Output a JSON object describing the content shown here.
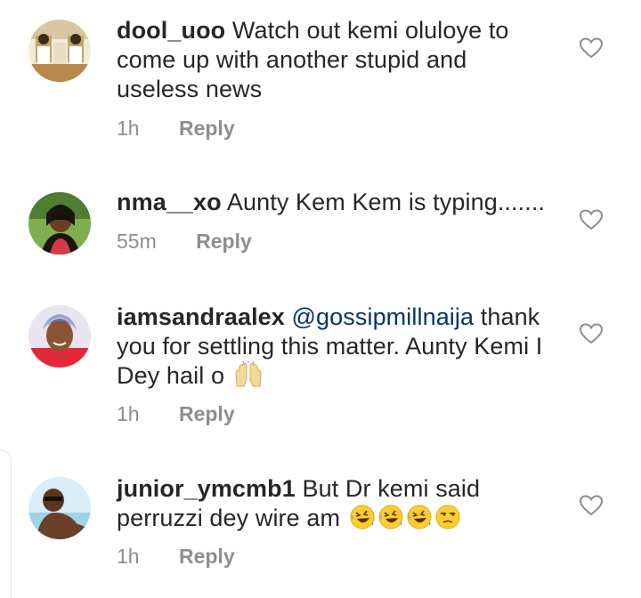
{
  "comments": [
    {
      "username": "dool_uoo",
      "text": "Watch out kemi oluloye to come up with another stupid and useless news",
      "time": "1h",
      "reply_label": "Reply"
    },
    {
      "username": "nma__xo",
      "text": "Aunty Kem Kem is typing.......",
      "time": "55m",
      "reply_label": "Reply"
    },
    {
      "username": "iamsandraalex",
      "mention": "@gossipmillnaija",
      "text": "thank you for settling this matter. Aunty Kemi I Dey hail o",
      "emojis": [
        "raising-hands-emoji"
      ],
      "time": "1h",
      "reply_label": "Reply"
    },
    {
      "username": "junior_ymcmb1",
      "text": "But Dr kemi said perruzzi dey wire am",
      "emojis": [
        "rolling-on-floor-laughing-emoji",
        "rolling-on-floor-laughing-emoji",
        "rolling-on-floor-laughing-emoji",
        "unamused-face-emoji"
      ],
      "time": "1h",
      "reply_label": "Reply"
    }
  ],
  "icons": {
    "like": "heart-outline-icon"
  },
  "colors": {
    "text": "#262626",
    "meta": "#8e8e8e",
    "mention": "#003569"
  }
}
